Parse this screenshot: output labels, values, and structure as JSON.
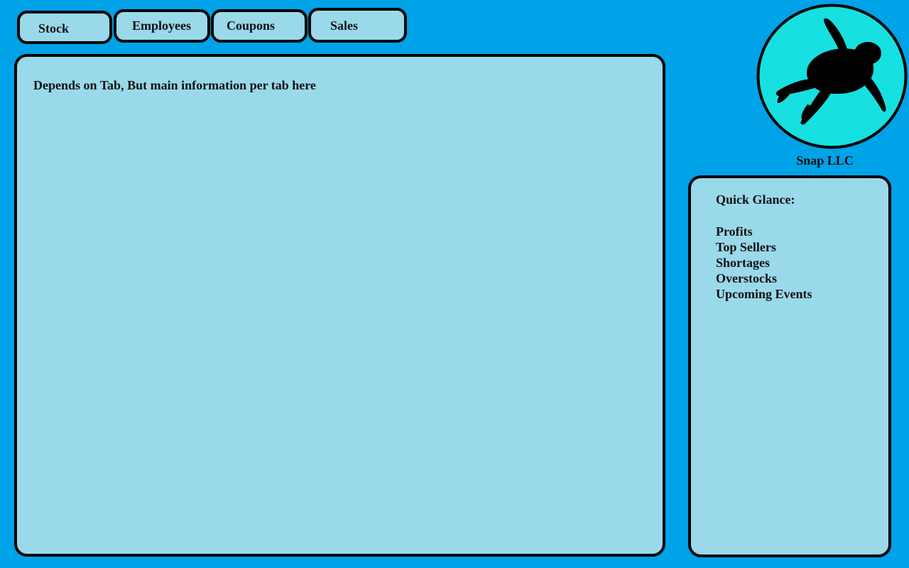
{
  "tabs": [
    {
      "id": "stock",
      "label": "Stock"
    },
    {
      "id": "employees",
      "label": "Employees"
    },
    {
      "id": "coupons",
      "label": "Coupons"
    },
    {
      "id": "sales",
      "label": "Sales"
    }
  ],
  "main": {
    "text": "Depends on Tab, But main information per tab here"
  },
  "brand": {
    "logo_icon": "sea-turtle-icon",
    "name": "Snap LLC",
    "logo_circle_color": "#16e0e0"
  },
  "sidebar": {
    "title": "Quick Glance:",
    "items": [
      {
        "label": "Profits"
      },
      {
        "label": "Top Sellers"
      },
      {
        "label": "Shortages"
      },
      {
        "label": "Overstocks"
      },
      {
        "label": "Upcoming Events"
      }
    ]
  },
  "colors": {
    "background": "#00a2e8",
    "panel": "#99d9ea",
    "border": "#000000"
  }
}
